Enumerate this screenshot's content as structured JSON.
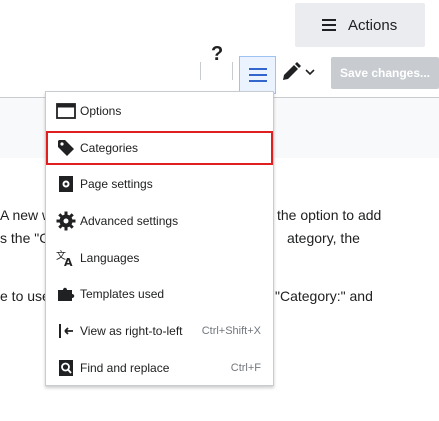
{
  "header": {
    "actions_label": "Actions"
  },
  "toolbar": {
    "help_label": "?",
    "save_label": "Save changes..."
  },
  "background_text": [
    "A new w",
    "the option to add",
    "s the \"C",
    "ategory, the",
    "e to use",
    "\"Category:\" and"
  ],
  "menu": {
    "items": [
      {
        "label": "Options",
        "icon": "options-icon",
        "shortcut": ""
      },
      {
        "label": "Categories",
        "icon": "tag-icon",
        "shortcut": ""
      },
      {
        "label": "Page settings",
        "icon": "page-settings-icon",
        "shortcut": ""
      },
      {
        "label": "Advanced settings",
        "icon": "gear-icon",
        "shortcut": ""
      },
      {
        "label": "Languages",
        "icon": "language-icon",
        "shortcut": ""
      },
      {
        "label": "Templates used",
        "icon": "puzzle-icon",
        "shortcut": ""
      },
      {
        "label": "View as right-to-left",
        "icon": "rtl-icon",
        "shortcut": "Ctrl+Shift+X"
      },
      {
        "label": "Find and replace",
        "icon": "find-replace-icon",
        "shortcut": "Ctrl+F"
      }
    ],
    "highlighted_index": 1
  },
  "colors": {
    "accent": "#3366cc",
    "highlight": "#e02020",
    "save_disabled": "#c8ccd1"
  }
}
